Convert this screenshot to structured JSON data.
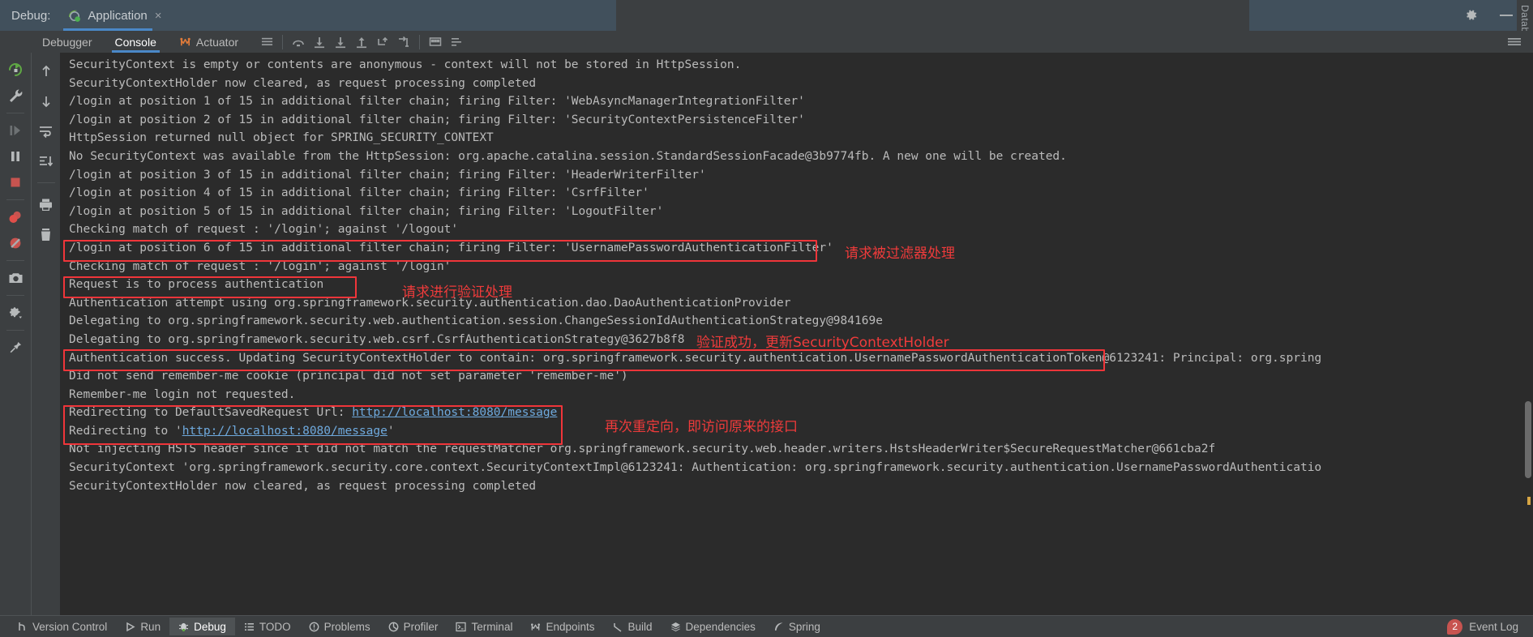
{
  "titlebar": {
    "debug_label": "Debug:",
    "run_config_name": "Application",
    "close_tab_glyph": "×",
    "settings_icon": "gear-icon",
    "minimize_glyph": "—",
    "layout_icon": "window-layout-icon"
  },
  "right_strip": {
    "label": "Database"
  },
  "tool_tabs": [
    {
      "label": "Debugger",
      "active": false
    },
    {
      "label": "Console",
      "active": true
    },
    {
      "label": "Actuator",
      "active": false,
      "icon": "actuator-icon"
    }
  ],
  "toolstrip_buttons": [
    {
      "name": "soft-wrap-icon"
    },
    {
      "name": "step-over-icon"
    },
    {
      "name": "step-into-icon"
    },
    {
      "name": "force-step-into-icon"
    },
    {
      "name": "step-out-icon"
    },
    {
      "name": "drop-frame-icon"
    },
    {
      "name": "run-to-cursor-icon"
    },
    {
      "name": "evaluate-expression-icon"
    },
    {
      "name": "settings-list-icon"
    },
    {
      "name": "hide-icon"
    }
  ],
  "left_rail": [
    {
      "name": "rerun-icon"
    },
    {
      "name": "edit-configuration-wrench-icon"
    },
    {
      "name": "resume-program-icon"
    },
    {
      "name": "pause-program-icon"
    },
    {
      "name": "stop-icon"
    },
    {
      "name": "view-breakpoints-icon"
    },
    {
      "name": "mute-breakpoints-icon"
    },
    {
      "name": "screenshot-icon"
    },
    {
      "name": "settings-gear-icon"
    },
    {
      "name": "pin-tab-icon"
    }
  ],
  "console_rail": [
    {
      "name": "scroll-up-icon"
    },
    {
      "name": "scroll-down-icon"
    },
    {
      "name": "soft-wrap-lines-icon"
    },
    {
      "name": "scroll-to-end-icon"
    },
    {
      "name": "print-icon"
    },
    {
      "name": "clear-all-icon"
    }
  ],
  "console": {
    "lines": [
      {
        "text": "SecurityContext is empty or contents are anonymous - context will not be stored in HttpSession."
      },
      {
        "text": "SecurityContextHolder now cleared, as request processing completed"
      },
      {
        "text": "/login at position 1 of 15 in additional filter chain; firing Filter: 'WebAsyncManagerIntegrationFilter'"
      },
      {
        "text": "/login at position 2 of 15 in additional filter chain; firing Filter: 'SecurityContextPersistenceFilter'"
      },
      {
        "text": "HttpSession returned null object for SPRING_SECURITY_CONTEXT"
      },
      {
        "text": "No SecurityContext was available from the HttpSession: org.apache.catalina.session.StandardSessionFacade@3b9774fb. A new one will be created."
      },
      {
        "text": "/login at position 3 of 15 in additional filter chain; firing Filter: 'HeaderWriterFilter'"
      },
      {
        "text": "/login at position 4 of 15 in additional filter chain; firing Filter: 'CsrfFilter'"
      },
      {
        "text": "/login at position 5 of 15 in additional filter chain; firing Filter: 'LogoutFilter'"
      },
      {
        "text": "Checking match of request : '/login'; against '/logout'"
      },
      {
        "text": "/login at position 6 of 15 in additional filter chain; firing Filter: 'UsernamePasswordAuthenticationFilter'"
      },
      {
        "text": "Checking match of request : '/login'; against '/login'"
      },
      {
        "text": "Request is to process authentication"
      },
      {
        "text": "Authentication attempt using org.springframework.security.authentication.dao.DaoAuthenticationProvider"
      },
      {
        "text": "Delegating to org.springframework.security.web.authentication.session.ChangeSessionIdAuthenticationStrategy@984169e"
      },
      {
        "text": "Delegating to org.springframework.security.web.csrf.CsrfAuthenticationStrategy@3627b8f8"
      },
      {
        "text": "Authentication success. Updating SecurityContextHolder to contain: org.springframework.security.authentication.UsernamePasswordAuthenticationToken@6123241: Principal: org.spring"
      },
      {
        "text": "Did not send remember-me cookie (principal did not set parameter 'remember-me')"
      },
      {
        "text": "Remember-me login not requested."
      },
      {
        "text": "Redirecting to DefaultSavedRequest Url: ",
        "link": "http://localhost:8080/message",
        "after": ""
      },
      {
        "text": "Redirecting to '",
        "link": "http://localhost:8080/message",
        "after": "'"
      },
      {
        "text": "Not injecting HSTS header since it did not match the requestMatcher org.springframework.security.web.header.writers.HstsHeaderWriter$SecureRequestMatcher@661cba2f"
      },
      {
        "text": "SecurityContext 'org.springframework.security.core.context.SecurityContextImpl@6123241: Authentication: org.springframework.security.authentication.UsernamePasswordAuthenticatio"
      },
      {
        "text": "SecurityContextHolder now cleared, as request processing completed"
      }
    ]
  },
  "annotations": [
    {
      "name": "annotation-filter-handled",
      "text": "请求被过滤器处理"
    },
    {
      "name": "annotation-process-authentication",
      "text": "请求进行验证处理"
    },
    {
      "name": "annotation-auth-success",
      "text": "验证成功，更新SecurityContextHolder"
    },
    {
      "name": "annotation-redirect",
      "text": "再次重定向，即访问原来的接口"
    }
  ],
  "statusbar": {
    "items": [
      {
        "label": "Version Control",
        "icon": "branch-icon",
        "active": false
      },
      {
        "label": "Run",
        "icon": "play-icon",
        "active": false
      },
      {
        "label": "Debug",
        "icon": "bug-icon",
        "active": true
      },
      {
        "label": "TODO",
        "icon": "list-icon",
        "active": false
      },
      {
        "label": "Problems",
        "icon": "warning-icon",
        "active": false
      },
      {
        "label": "Profiler",
        "icon": "profiler-icon",
        "active": false
      },
      {
        "label": "Terminal",
        "icon": "terminal-icon",
        "active": false
      },
      {
        "label": "Endpoints",
        "icon": "endpoints-icon",
        "active": false
      },
      {
        "label": "Build",
        "icon": "hammer-icon",
        "active": false
      },
      {
        "label": "Dependencies",
        "icon": "layers-icon",
        "active": false
      },
      {
        "label": "Spring",
        "icon": "spring-leaf-icon",
        "active": false
      }
    ],
    "event_log": {
      "label": "Event Log",
      "count": "2"
    }
  },
  "colors": {
    "accent_blue": "#4a88c7",
    "annotation_red": "#ef3b3b",
    "console_bg": "#2b2b2b",
    "console_fg": "#bbbbbb",
    "link_blue": "#6faade",
    "panel_bg": "#3c3f41",
    "title_bg": "#41505c",
    "badge_red": "#c75450"
  }
}
